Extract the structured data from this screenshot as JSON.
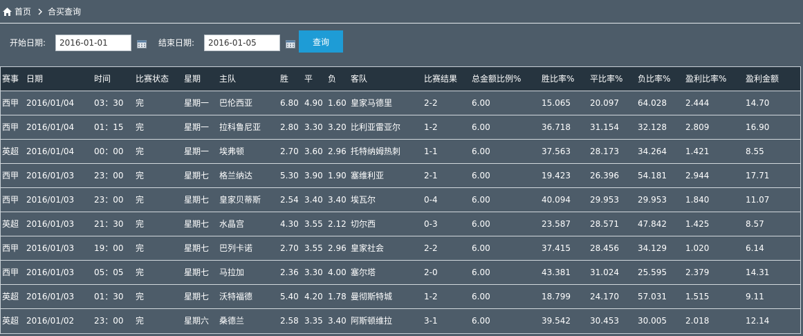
{
  "breadcrumb": {
    "home": "首页",
    "current": "合买查询"
  },
  "filter": {
    "start_label": "开始日期:",
    "start_value": "2016-01-01",
    "end_label": "结束日期:",
    "end_value": "2016-01-05",
    "query_label": "查询"
  },
  "table": {
    "headers": [
      "赛事",
      "日期",
      "时间",
      "比赛状态",
      "星期",
      "主队",
      "胜",
      "平",
      "负",
      "客队",
      "比赛结果",
      "总金额比例%",
      "胜比率%",
      "平比率%",
      "负比率%",
      "盈利比率%",
      "盈利金额"
    ],
    "rows": [
      [
        "西甲",
        "2016/01/04",
        "03：30",
        "完",
        "星期一",
        "巴伦西亚",
        "6.80",
        "4.90",
        "1.60",
        "皇家马德里",
        "2-2",
        "6.00",
        "15.065",
        "20.097",
        "64.028",
        "2.444",
        "14.70"
      ],
      [
        "西甲",
        "2016/01/04",
        "01：15",
        "完",
        "星期一",
        "拉科鲁尼亚",
        "2.80",
        "3.30",
        "3.20",
        "比利亚雷亚尔",
        "1-2",
        "6.00",
        "36.718",
        "31.154",
        "32.128",
        "2.809",
        "16.90"
      ],
      [
        "英超",
        "2016/01/04",
        "00：00",
        "完",
        "星期一",
        "埃弗顿",
        "2.70",
        "3.60",
        "2.96",
        "托特纳姆热刺",
        "1-1",
        "6.00",
        "37.563",
        "28.173",
        "34.264",
        "1.421",
        "8.55"
      ],
      [
        "西甲",
        "2016/01/03",
        "23：00",
        "完",
        "星期七",
        "格兰纳达",
        "5.30",
        "3.90",
        "1.90",
        "塞维利亚",
        "2-1",
        "6.00",
        "19.423",
        "26.396",
        "54.181",
        "2.944",
        "17.71"
      ],
      [
        "西甲",
        "2016/01/03",
        "23：00",
        "完",
        "星期七",
        "皇家贝蒂斯",
        "2.54",
        "3.40",
        "3.40",
        "埃瓦尔",
        "0-4",
        "6.00",
        "40.094",
        "29.953",
        "29.953",
        "1.840",
        "11.07"
      ],
      [
        "英超",
        "2016/01/03",
        "21：30",
        "完",
        "星期七",
        "水晶宫",
        "4.30",
        "3.55",
        "2.12",
        "切尔西",
        "0-3",
        "6.00",
        "23.587",
        "28.571",
        "47.842",
        "1.425",
        "8.57"
      ],
      [
        "西甲",
        "2016/01/03",
        "19：00",
        "完",
        "星期七",
        "巴列卡诺",
        "2.70",
        "3.55",
        "2.96",
        "皇家社会",
        "2-2",
        "6.00",
        "37.415",
        "28.456",
        "34.129",
        "1.020",
        "6.14"
      ],
      [
        "西甲",
        "2016/01/03",
        "05：05",
        "完",
        "星期七",
        "马拉加",
        "2.36",
        "3.30",
        "4.00",
        "塞尔塔",
        "2-0",
        "6.00",
        "43.381",
        "31.024",
        "25.595",
        "2.379",
        "14.31"
      ],
      [
        "英超",
        "2016/01/03",
        "01：30",
        "完",
        "星期七",
        "沃特福德",
        "5.40",
        "4.20",
        "1.78",
        "曼彻斯特城",
        "1-2",
        "6.00",
        "18.799",
        "24.170",
        "57.031",
        "1.515",
        "9.11"
      ],
      [
        "英超",
        "2016/01/02",
        "23：00",
        "完",
        "星期六",
        "桑德兰",
        "2.58",
        "3.35",
        "3.40",
        "阿斯顿维拉",
        "3-1",
        "6.00",
        "39.542",
        "30.453",
        "30.005",
        "2.018",
        "12.14"
      ]
    ]
  }
}
